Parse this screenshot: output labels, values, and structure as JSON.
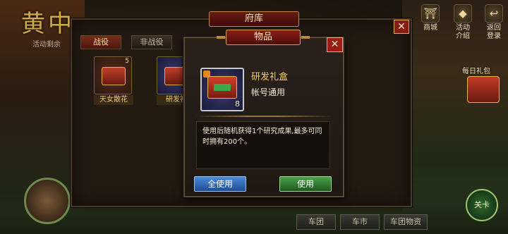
{
  "background": {
    "title": "黄中",
    "subtitle": "活动剩余",
    "right_icons": [
      {
        "label": "商城",
        "icon": "shop-icon"
      },
      {
        "label": "活动\n介绍",
        "icon": "event-info-icon"
      },
      {
        "label": "返回\n登录",
        "icon": "return-login-icon"
      }
    ],
    "daily_label": "每日礼包",
    "card_button": "关卡",
    "bottom_tabs": [
      "车团",
      "车市",
      "车团物资"
    ]
  },
  "treasury_panel": {
    "title": "府库",
    "tabs": [
      "战役",
      "非战役"
    ],
    "active_tab": "战役",
    "items": [
      {
        "label": "天女散花",
        "count": "5"
      },
      {
        "label": "研发礼",
        "count": ""
      }
    ]
  },
  "item_dialog": {
    "title": "物品",
    "item_name": "研发礼盒",
    "item_subtitle": "帐号通用",
    "item_count": "8",
    "description": "使用后随机获得1个研究成果,最多可同时拥有200个。",
    "buttons": {
      "use_all": "全使用",
      "use": "使用"
    }
  },
  "colors": {
    "accent_gold": "#f2cf6a",
    "title_red": "#8a1e16",
    "button_blue": "#1e4c94",
    "button_green": "#1e5a1e"
  }
}
